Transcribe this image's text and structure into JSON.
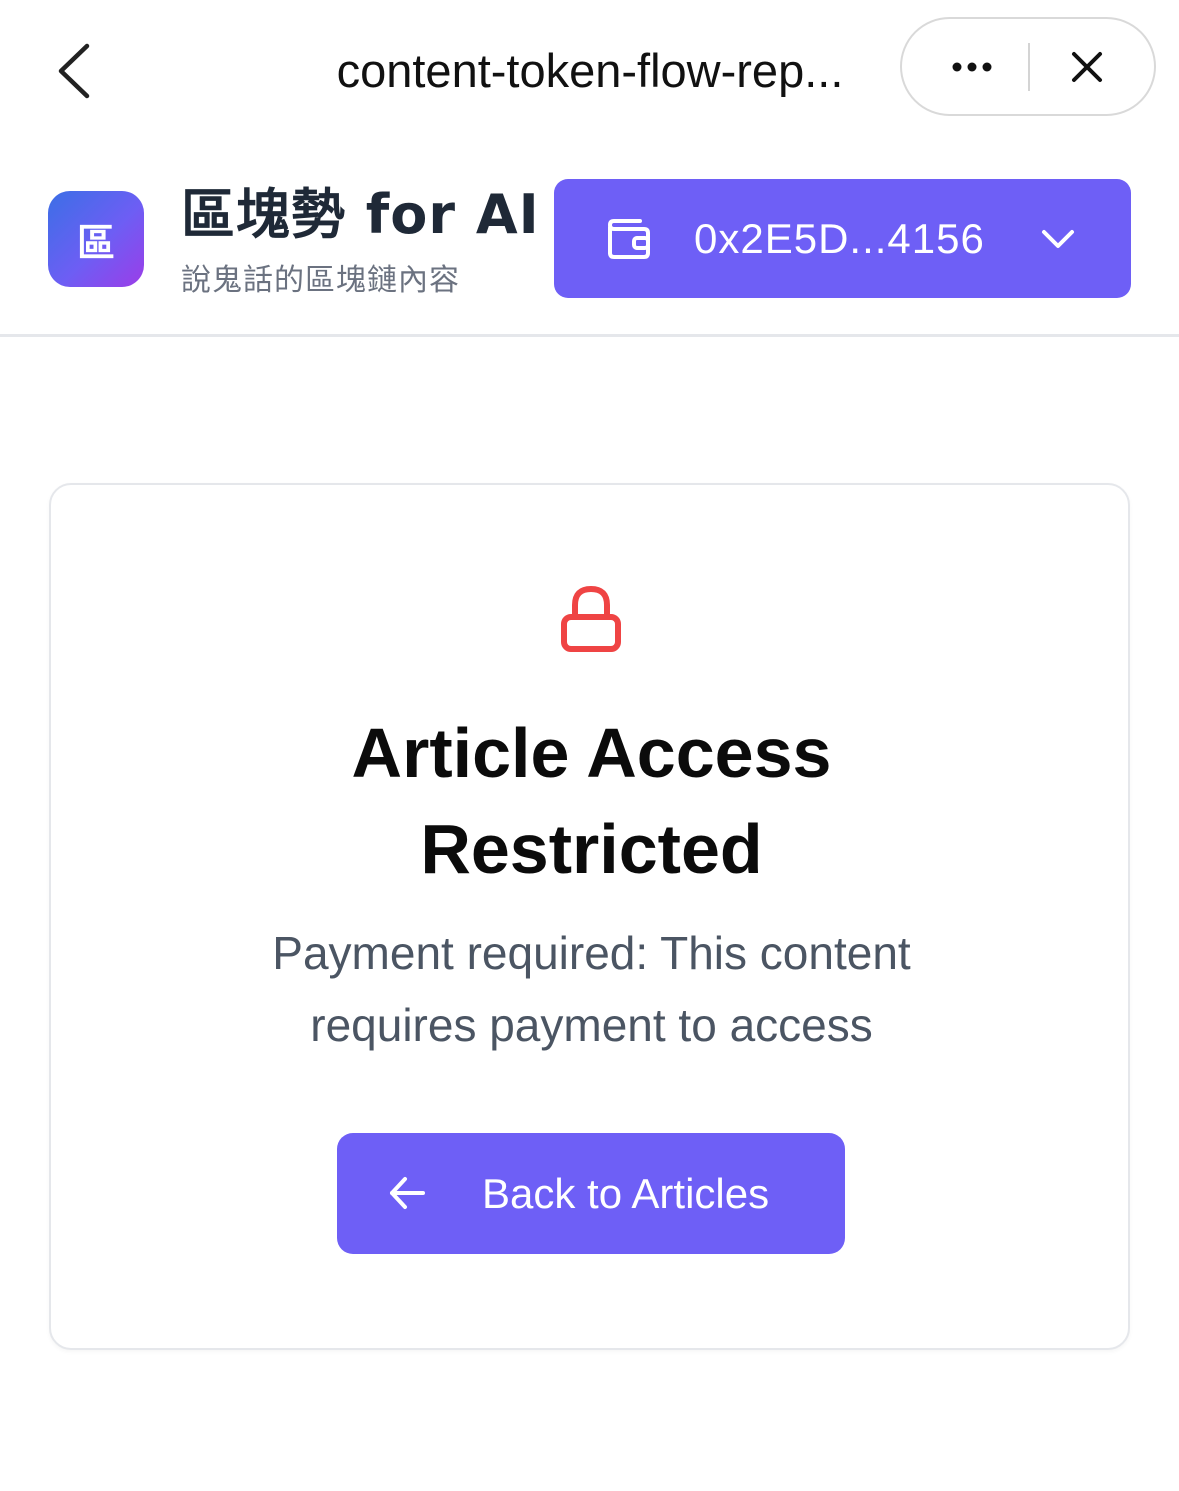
{
  "browser": {
    "page_title": "content-token-flow-rep...",
    "icons": {
      "back": "chevron-left-icon",
      "more": "more-horizontal-icon",
      "close": "close-icon"
    }
  },
  "header": {
    "logo_char": "區",
    "brand_name": "區塊勢 for AI",
    "brand_subtitle": "說鬼話的區塊鏈內容",
    "wallet_address": "0x2E5D...4156",
    "wallet_icon": "wallet-icon",
    "dropdown_icon": "chevron-down-icon"
  },
  "card": {
    "lock_icon": "lock-icon",
    "title_line1": "Article Access",
    "title_line2": "Restricted",
    "message_line1": "Payment required: This content",
    "message_line2": "requires payment to access",
    "back_button_label": "Back to Articles",
    "back_button_icon": "arrow-left-icon"
  },
  "colors": {
    "accent": "#6e5ff6",
    "lock": "#ef4444",
    "title": "#0b0b0b",
    "message": "#4b5563",
    "brand_text": "#1f2937",
    "subtitle": "#6b7280",
    "border": "#e5e7eb"
  }
}
